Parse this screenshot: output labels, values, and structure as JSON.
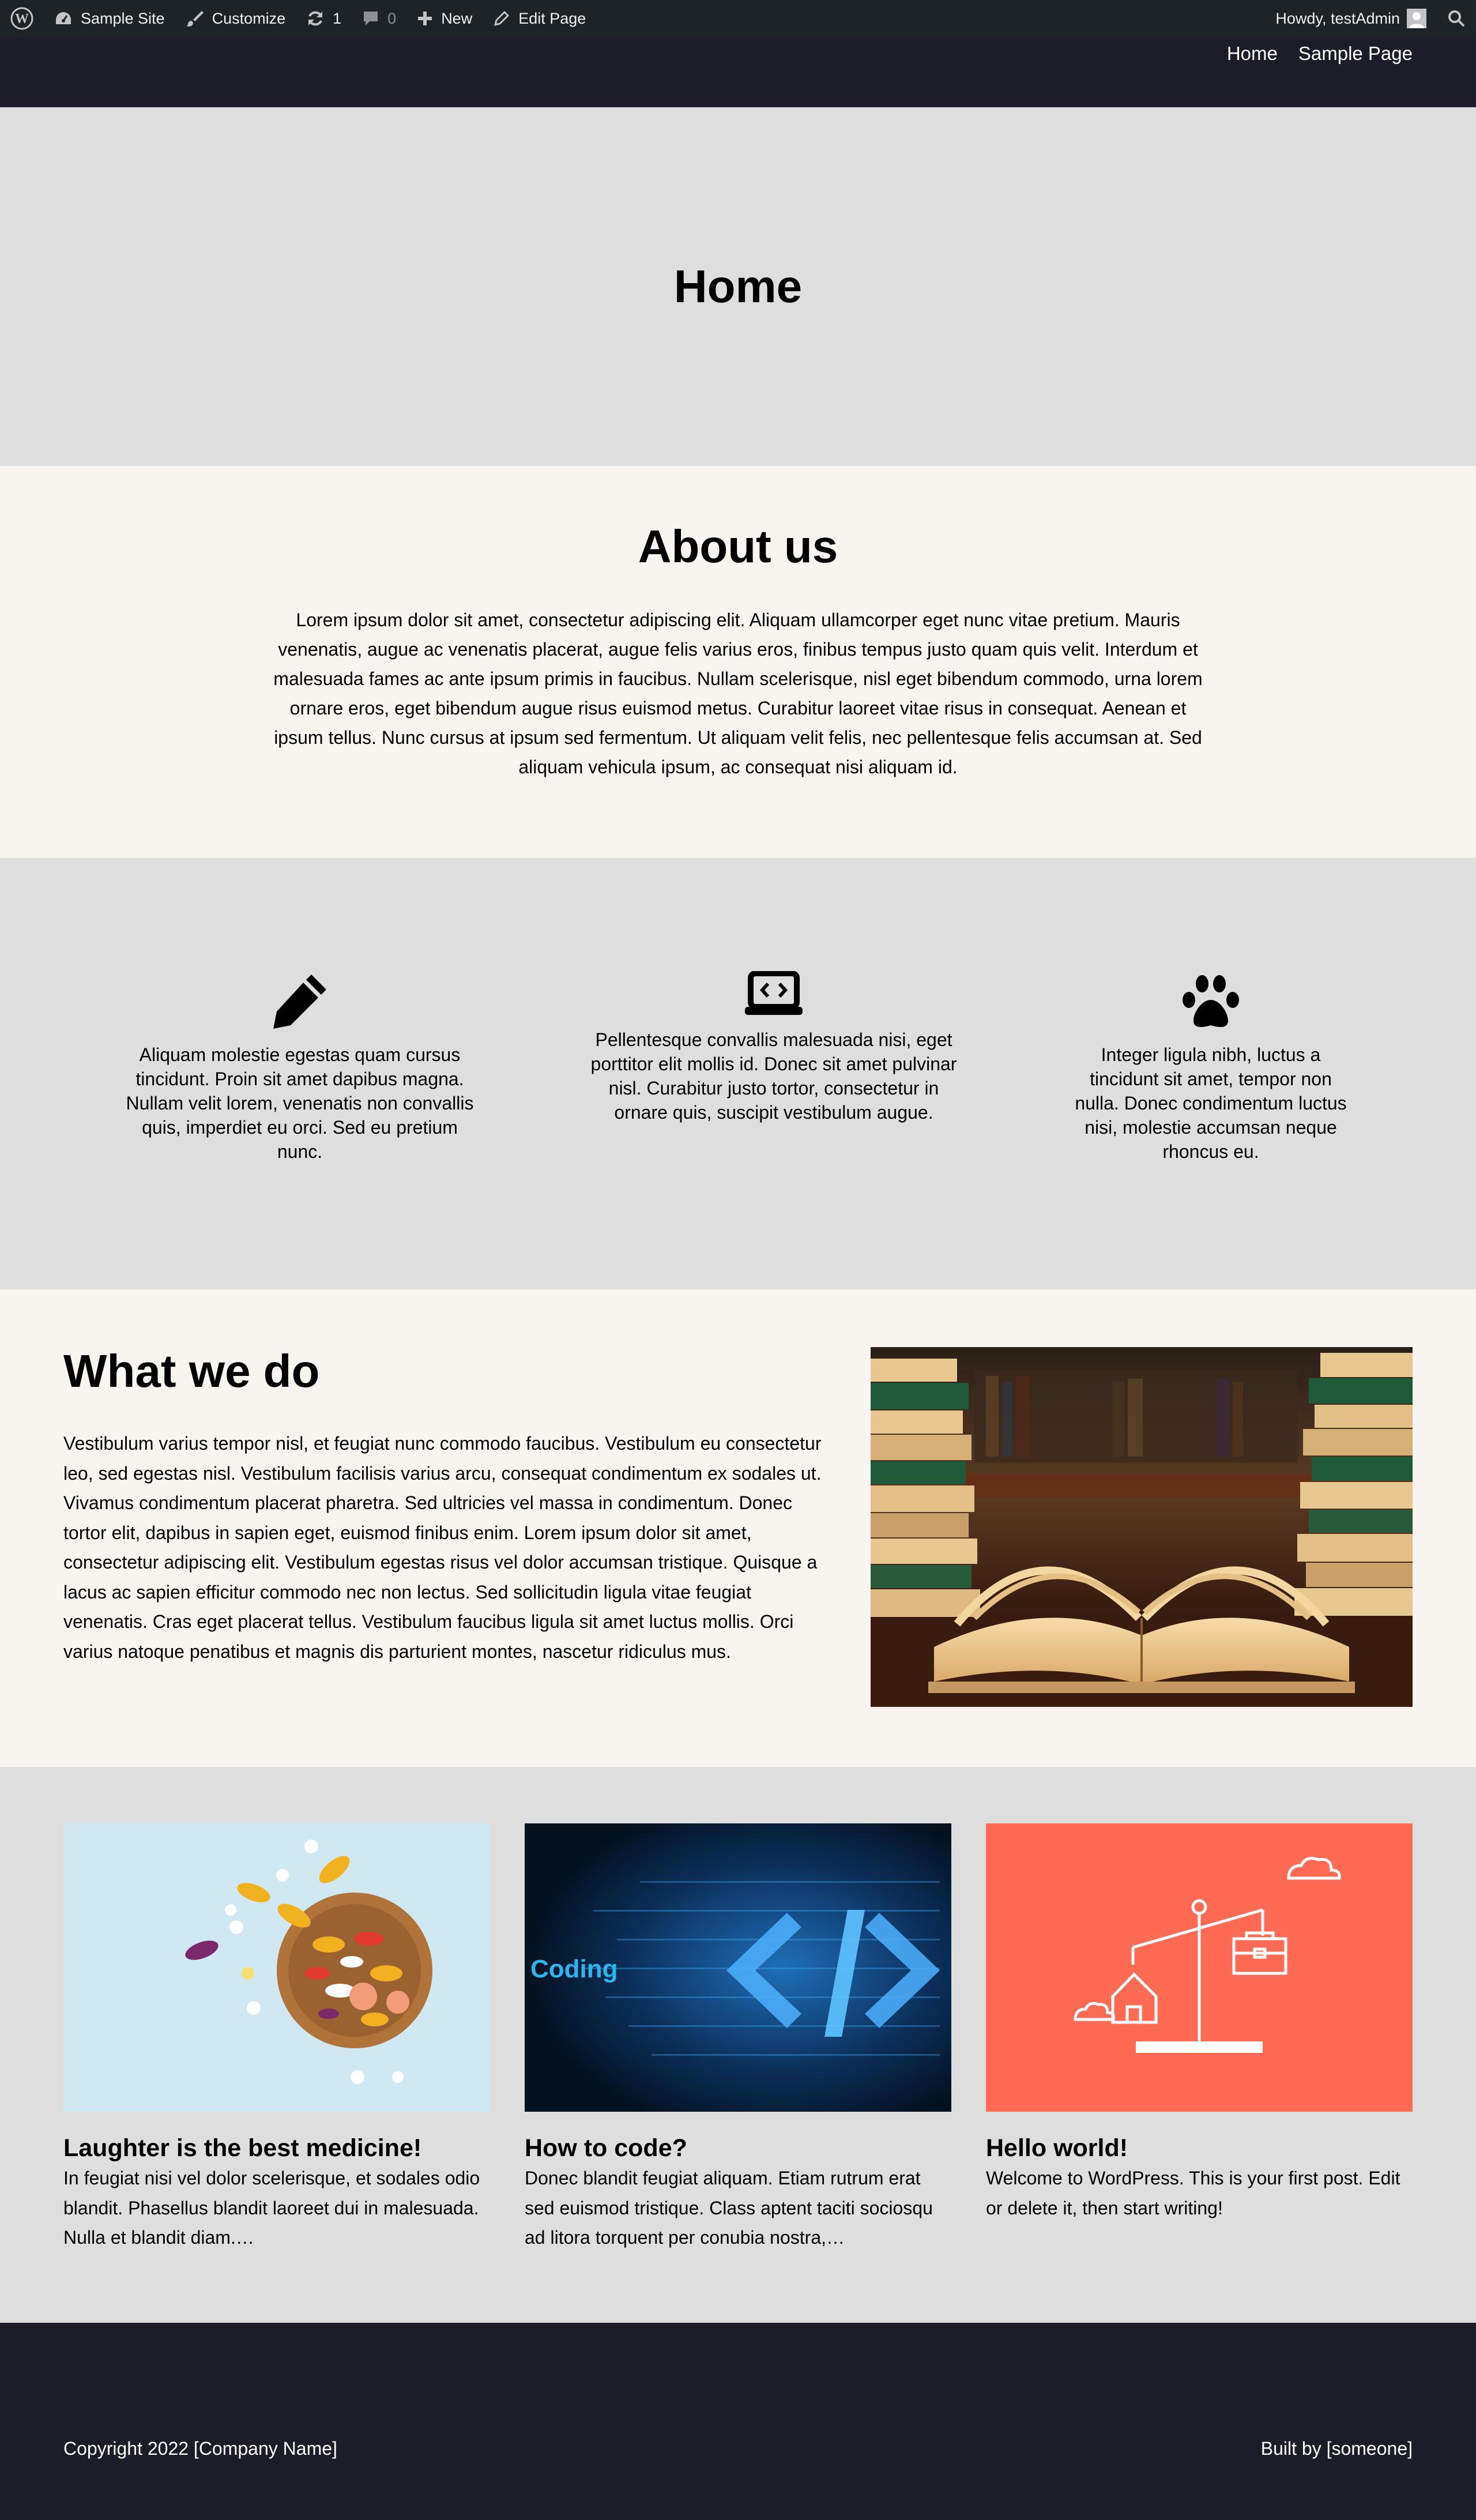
{
  "admin_bar": {
    "site_name": "Sample Site",
    "customize_label": "Customize",
    "updates_count": "1",
    "comments_count": "0",
    "new_label": "New",
    "edit_page_label": "Edit Page",
    "greeting": "Howdy, testAdmin"
  },
  "nav": {
    "items": [
      {
        "label": "Home"
      },
      {
        "label": "Sample Page"
      }
    ]
  },
  "hero": {
    "title": "Home"
  },
  "about": {
    "title": "About us",
    "body": "Lorem ipsum dolor sit amet, consectetur adipiscing elit. Aliquam ullamcorper eget nunc vitae pretium. Mauris venenatis, augue ac venenatis placerat, augue felis varius eros, finibus tempus justo quam quis velit. Interdum et malesuada fames ac ante ipsum primis in faucibus. Nullam scelerisque, nisl eget bibendum commodo, urna lorem ornare eros, eget bibendum augue risus euismod metus. Curabitur laoreet vitae risus in consequat. Aenean et ipsum tellus. Nunc cursus at ipsum sed fermentum. Ut aliquam velit felis, nec pellentesque felis accumsan at. Sed aliquam vehicula ipsum, ac consequat nisi aliquam id."
  },
  "features": [
    {
      "icon": "pencil-icon",
      "text": "Aliquam molestie egestas quam cursus tincidunt. Proin sit amet dapibus magna. Nullam velit lorem, venenatis non convallis quis, imperdiet eu orci. Sed eu pretium nunc."
    },
    {
      "icon": "laptop-code-icon",
      "text": "Pellentesque convallis malesuada nisi, eget porttitor elit mollis id. Donec sit amet pulvinar nisl. Curabitur justo tortor, consectetur in ornare quis, suscipit vestibulum augue."
    },
    {
      "icon": "paw-icon",
      "text": "Integer ligula nibh, luctus a tincidunt sit amet, tempor non nulla. Donec condimentum luctus nisi, molestie accumsan neque rhoncus eu."
    }
  ],
  "what_we_do": {
    "title": "What we do",
    "body": "Vestibulum varius tempor nisl, et feugiat nunc commodo faucibus. Vestibulum eu consectetur leo, sed egestas nisl. Vestibulum facilisis varius arcu, consequat condimentum ex sodales ut. Vivamus condimentum placerat pharetra. Sed ultricies vel massa in condimentum. Donec tortor elit, dapibus in sapien eget, euismod finibus enim. Lorem ipsum dolor sit amet, consectetur adipiscing elit. Vestibulum egestas risus vel dolor accumsan tristique. Quisque a lacus ac sapien efficitur commodo nec non lectus. Sed sollicitudin ligula vitae feugiat venenatis. Cras eget placerat tellus. Vestibulum faucibus ligula sit amet luctus mollis. Orci varius natoque penatibus et magnis dis parturient montes, nascetur ridiculus mus."
  },
  "posts": [
    {
      "title": "Laughter is the best medicine!",
      "excerpt": "In feugiat nisi vel dolor scelerisque, et sodales odio blandit. Phasellus blandit laoreet dui in malesuada. Nulla et blandit diam.…"
    },
    {
      "title": "How to code?",
      "excerpt": "Donec blandit feugiat aliquam. Etiam rutrum erat sed euismod tristique. Class aptent taciti sociosqu ad litora torquent per conubia nostra,…",
      "image_caption": "Coding"
    },
    {
      "title": "Hello world!",
      "excerpt": "Welcome to WordPress. This is your first post. Edit or delete it, then start writing!"
    }
  ],
  "footer": {
    "copyright": "Copyright 2022 [Company Name]",
    "credit": "Built by [someone]"
  },
  "colors": {
    "admin_bar": "#1d2327",
    "header_footer": "#1c1d29",
    "gray_section": "#dedede",
    "cream_section": "#f8f5f0",
    "coral": "#ff6b55"
  }
}
